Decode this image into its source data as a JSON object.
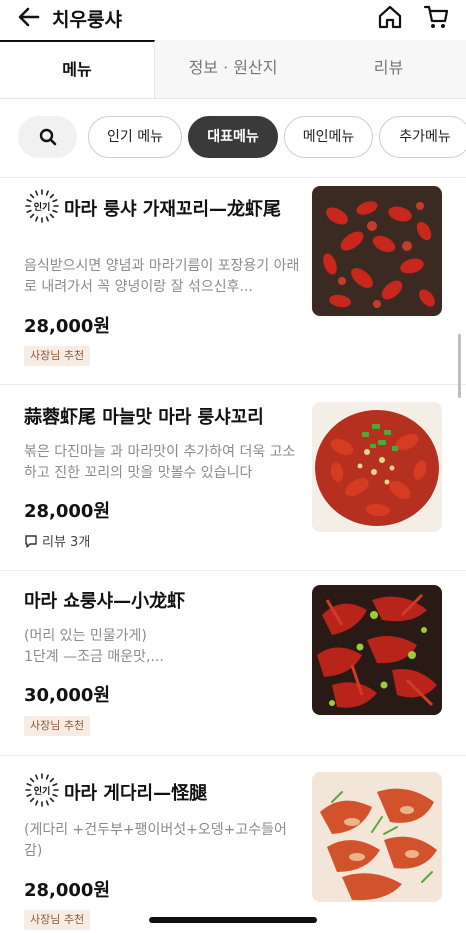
{
  "header": {
    "title": "치우룽샤",
    "back_icon": "arrow-left-icon",
    "home_icon": "home-icon",
    "cart_icon": "cart-icon"
  },
  "tabs": [
    {
      "label": "메뉴",
      "active": true
    },
    {
      "label": "정보 · 원산지",
      "active": false
    },
    {
      "label": "리뷰",
      "active": false
    }
  ],
  "chips": {
    "search_icon": "search-icon",
    "items": [
      {
        "label": "인기 메뉴",
        "selected": false
      },
      {
        "label": "대표메뉴",
        "selected": true
      },
      {
        "label": "메인메뉴",
        "selected": false
      },
      {
        "label": "추가메뉴",
        "selected": false
      }
    ]
  },
  "popular_badge_text": "인기",
  "menu_items": [
    {
      "popular": true,
      "name": "마라 룽샤 가재꼬리—龙虾尾",
      "desc": "음식받으시면 양념과 마라기름이 포장용기 아래로 내려가서 꼭 양녕이랑 잘 섞으신후...",
      "price": "28,000원",
      "tag": "사장님 추천",
      "review": null
    },
    {
      "popular": false,
      "name": "蒜蓉虾尾 마늘맛 마라 룽샤꼬리",
      "desc": "볶은 다진마늘 과 마라맛이 추가하여 더욱 고소하고 진한 꼬리의 맛을 맛볼수 있습니다",
      "price": "28,000원",
      "tag": null,
      "review": "리뷰 3개"
    },
    {
      "popular": false,
      "name": "마라 쇼룽샤—小龙虾",
      "desc": "(머리 있는 민물가게)\n1단계 —조금 매운맛,...",
      "price": "30,000원",
      "tag": "사장님 추천",
      "review": null
    },
    {
      "popular": true,
      "name": "마라 게다리—怪腿",
      "desc": "(게다리 +건두부+팽이버섯+오뎅+고수들어감)",
      "price": "28,000원",
      "tag": "사장님 추천",
      "review": null
    }
  ],
  "colors": {
    "selected_chip_bg": "#3a3a3a",
    "tag_bg": "#f6ece4",
    "tag_text": "#8a5a3a",
    "desc_text": "#8b8b8b"
  }
}
